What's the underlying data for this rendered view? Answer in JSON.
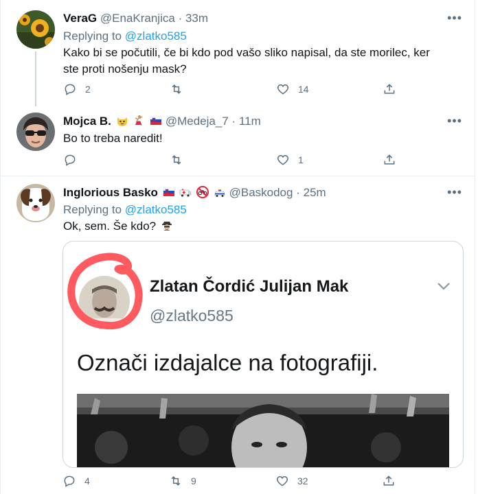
{
  "tweets": [
    {
      "name": "VeraG",
      "handle": "@EnaKranjica",
      "time": "33m",
      "replying_prefix": "Replying to ",
      "replying_to": "@zlatko585",
      "text": "Kako bi se počutili, če bi kdo pod vašo sliko napisal, da ste morilec, ker ste proti nošenju mask?",
      "replies": "2",
      "retweets": "",
      "likes": "14"
    },
    {
      "name": "Mojca B.",
      "handle": "@Medeja_7",
      "time": "11m",
      "text": "Bo to treba naredit!",
      "replies": "",
      "retweets": "",
      "likes": "1"
    },
    {
      "name": "Inglorious Basko",
      "handle": "@Baskodog",
      "time": "25m",
      "replying_prefix": "Replying to ",
      "replying_to": "@zlatko585",
      "text": "Ok, sem. Še kdo?",
      "replies": "4",
      "retweets": "9",
      "likes": "32"
    }
  ],
  "embedded_image": {
    "name": "Zlatan Čordić Julijan Mak",
    "handle": "@zlatko585",
    "text": "Označi izdajalce na fotografiji."
  },
  "separator": "·",
  "more_glyph": "•••",
  "icons": [
    "reply-icon",
    "retweet-icon",
    "like-icon",
    "share-icon",
    "more-icon"
  ],
  "colors": {
    "link": "#1da1f2",
    "muted": "#5b7083",
    "border": "#e6ecf0",
    "marker": "#ff5a5f"
  }
}
